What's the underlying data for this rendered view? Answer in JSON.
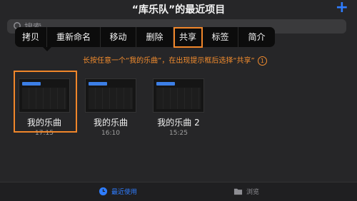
{
  "header": {
    "title": "“库乐队”的最近项目",
    "add_icon": "plus-icon"
  },
  "search": {
    "placeholder": "搜索"
  },
  "context_menu": {
    "items": [
      {
        "label": "拷贝"
      },
      {
        "label": "重新命名"
      },
      {
        "label": "移动"
      },
      {
        "label": "删除"
      },
      {
        "label": "共享"
      },
      {
        "label": "标签"
      },
      {
        "label": "简介"
      }
    ]
  },
  "hint": {
    "text": "长按任意一个“我的乐曲”，在出现提示框后选择“共享”",
    "step": "1"
  },
  "files": [
    {
      "name": "我的乐曲",
      "time": "17:15"
    },
    {
      "name": "我的乐曲",
      "time": "16:10"
    },
    {
      "name": "我的乐曲 2",
      "time": "15:25"
    }
  ],
  "tabbar": {
    "recent": {
      "label": "最近使用",
      "color": "#2f7dff"
    },
    "browse": {
      "label": "浏览",
      "color": "#8e8e93"
    }
  },
  "colors": {
    "accent": "#2f7dff",
    "highlight": "#f0862a"
  }
}
